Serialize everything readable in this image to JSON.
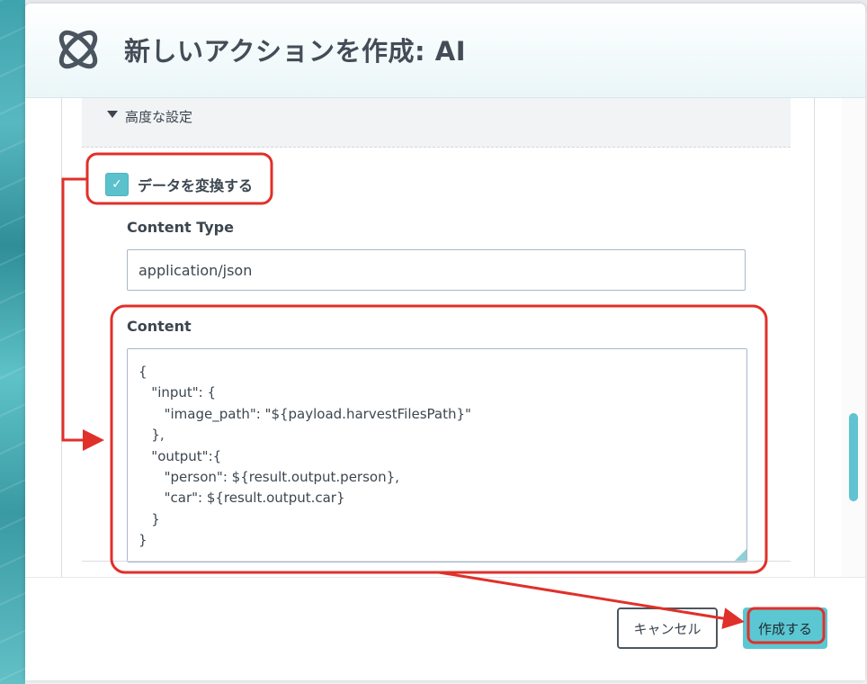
{
  "dialog": {
    "title": "新しいアクションを作成: AI",
    "icon": "atom-icon"
  },
  "advanced": {
    "label": "高度な設定",
    "icon": "triangle-down-icon"
  },
  "transform": {
    "checkbox_label": "データを変換する",
    "checked": true,
    "check_glyph": "✓"
  },
  "content_type": {
    "label": "Content Type",
    "value": "application/json"
  },
  "content": {
    "label": "Content",
    "value": "{\n   \"input\": {\n      \"image_path\": \"${payload.harvestFilesPath}\"\n   },\n   \"output\":{\n      \"person\": ${result.output.person},\n      \"car\": ${result.output.car}\n   }\n}"
  },
  "footer": {
    "cancel_label": "キャンセル",
    "create_label": "作成する"
  },
  "colors": {
    "accent": "#5bc7d2",
    "annotation_red": "#e0302a",
    "title_text": "#444d57"
  }
}
